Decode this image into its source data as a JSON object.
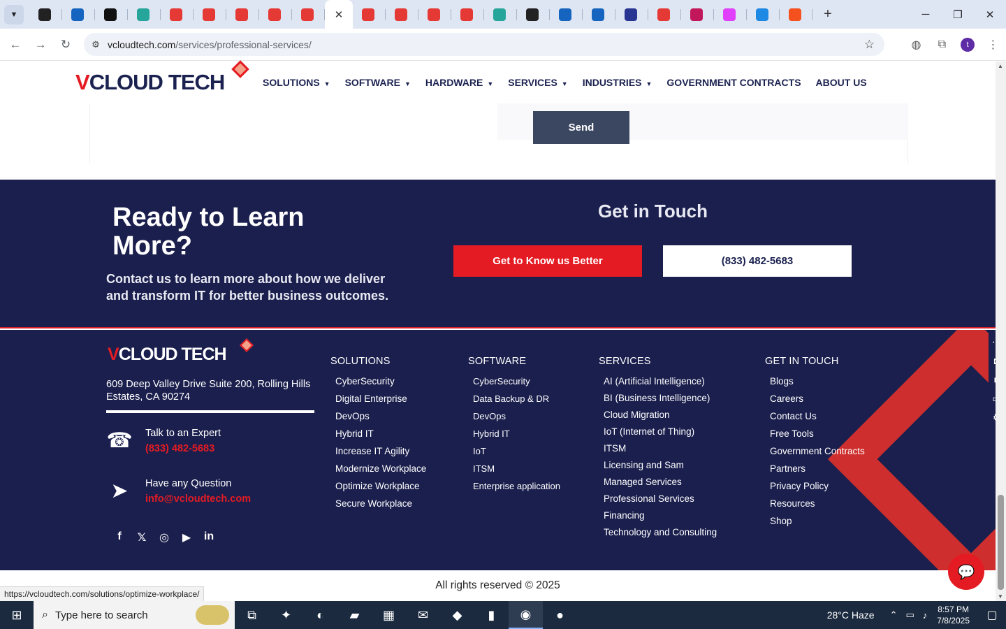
{
  "browser": {
    "active_tab_close": "✕",
    "new_tab": "+",
    "url_host": "vcloudtech.com",
    "url_path": "/services/professional-services/",
    "avatar_letter": "t",
    "status_url": "https://vcloudtech.com/solutions/optimize-workplace/"
  },
  "tab_colors": [
    "#222222",
    "#1565c0",
    "#111111",
    "#26a69a",
    "#e53935",
    "#e53935",
    "#e53935",
    "#e53935",
    "#e53935",
    "#e53935",
    "#e53935",
    "#e53935",
    "#e53935",
    "#e53935",
    "#26a69a",
    "#222222",
    "#1565c0",
    "#1565c0",
    "#283593",
    "#e53935",
    "#c2185b",
    "#e040fb",
    "#1e88e5",
    "#f4511e"
  ],
  "site": {
    "logo": {
      "v": "V",
      "cloud": "CLOUD",
      "tech": "TECH"
    },
    "nav": [
      {
        "label": "SOLUTIONS",
        "caret": true
      },
      {
        "label": "SOFTWARE",
        "caret": true
      },
      {
        "label": "HARDWARE",
        "caret": true
      },
      {
        "label": "SERVICES",
        "caret": true
      },
      {
        "label": "INDUSTRIES",
        "caret": true
      },
      {
        "label": "GOVERNMENT CONTRACTS",
        "caret": false
      },
      {
        "label": "ABOUT US",
        "caret": false
      }
    ],
    "send_label": "Send"
  },
  "cta": {
    "title": "Ready to Learn More?",
    "text": "Contact us to learn more about how we deliver and transform IT for better business outcomes.",
    "get_in_touch": "Get in Touch",
    "btn_primary": "Get to Know us Better",
    "btn_phone": "(833) 482-5683"
  },
  "footer": {
    "address": "609 Deep Valley Drive Suite 200, Rolling Hills Estates, CA 90274",
    "talk_label": "Talk to an Expert",
    "talk_phone": "(833) 482-5683",
    "question_label": "Have any Question",
    "question_email": "info@vcloudtech.com",
    "solutions": {
      "heading": "SOLUTIONS",
      "links": [
        "CyberSecurity",
        "Digital Enterprise",
        "DevOps",
        "Hybrid IT",
        "Increase IT Agility",
        "Modernize Workplace",
        "Optimize Workplace",
        "Secure Workplace"
      ]
    },
    "software": {
      "heading": "SOFTWARE",
      "links": [
        "CyberSecurity",
        "Data Backup & DR",
        "DevOps",
        "Hybrid IT",
        "IoT",
        "ITSM",
        "Enterprise application"
      ]
    },
    "services": {
      "heading": "SERVICES",
      "links": [
        "AI (Artificial Intelligence)",
        "BI (Business Intelligence)",
        "Cloud Migration",
        "IoT (Internet of Thing)",
        "ITSM",
        "Licensing and Sam",
        "Managed Services",
        "Professional Services",
        "Financing",
        "Technology and Consulting"
      ]
    },
    "get_in_touch": {
      "heading": "GET IN TOUCH",
      "links": [
        "Blogs",
        "Careers",
        "Contact Us",
        "Free Tools",
        "Government Contracts",
        "Partners",
        "Privacy Policy",
        "Resources",
        "Shop"
      ]
    },
    "copyright": "All rights reserved © 2025"
  },
  "taskbar": {
    "search_placeholder": "Type here to search",
    "weather": "28°C  Haze",
    "time": "8:57 PM",
    "date": "7/8/2025"
  },
  "colors": {
    "navy": "#1b1f4d",
    "red": "#e41b23",
    "send_btn": "#3b4761"
  }
}
